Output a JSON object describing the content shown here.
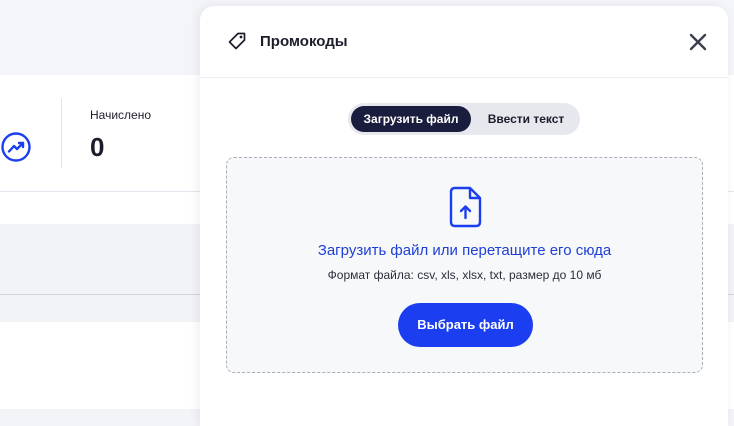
{
  "background": {
    "stat": {
      "label": "Начислено",
      "value": "0"
    }
  },
  "drawer": {
    "title": "Промокоды",
    "tabs": [
      {
        "label": "Загрузить файл",
        "active": true
      },
      {
        "label": "Ввести текст",
        "active": false
      }
    ],
    "dropzone": {
      "title": "Загрузить файл или перетащите его сюда",
      "hint": "Формат файла: csv, xls, xlsx, txt, размер до 10 мб",
      "button_label": "Выбрать файл"
    }
  },
  "colors": {
    "accent": "#1b3ff0",
    "link": "#1f3fd6",
    "tab_active_bg": "#1a1d3d",
    "text": "#1c1d2b"
  },
  "icons": {
    "stat": "trending-up-icon",
    "title": "tag-icon",
    "close": "close-icon",
    "upload": "file-upload-icon"
  }
}
